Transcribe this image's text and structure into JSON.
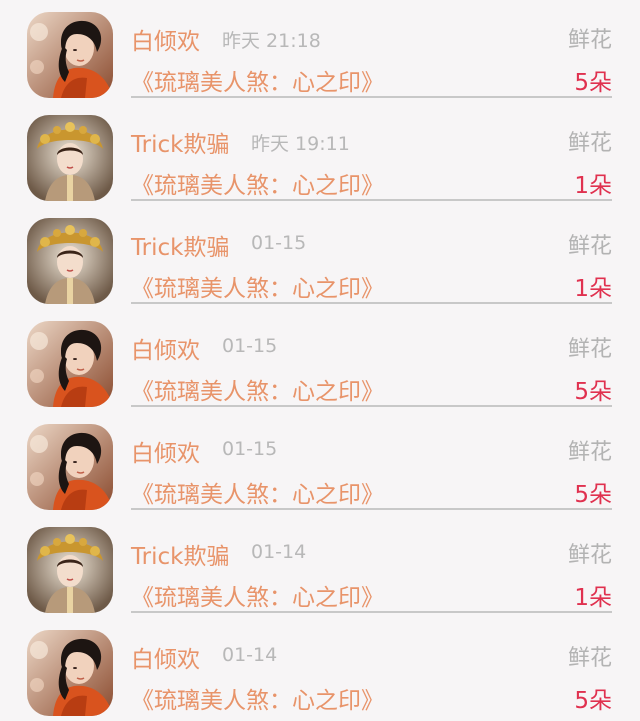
{
  "colors": {
    "background": "#f7f5f6",
    "name": "#e8946a",
    "time": "#b8b8b8",
    "kind": "#b3b3b3",
    "count": "#e0314f",
    "divider": "#c8c8c8"
  },
  "records": [
    {
      "avatar": "avatar-red-robe",
      "name": "白倾欢",
      "time": "昨天 21:18",
      "kind": "鲜花",
      "work": "《琉璃美人煞：心之印》",
      "count": "5朵"
    },
    {
      "avatar": "avatar-golden-headdress",
      "name": "Trick欺骗",
      "time": "昨天 19:11",
      "kind": "鲜花",
      "work": "《琉璃美人煞：心之印》",
      "count": "1朵"
    },
    {
      "avatar": "avatar-golden-headdress",
      "name": "Trick欺骗",
      "time": "01-15",
      "kind": "鲜花",
      "work": "《琉璃美人煞：心之印》",
      "count": "1朵"
    },
    {
      "avatar": "avatar-red-robe",
      "name": "白倾欢",
      "time": "01-15",
      "kind": "鲜花",
      "work": "《琉璃美人煞：心之印》",
      "count": "5朵"
    },
    {
      "avatar": "avatar-red-robe",
      "name": "白倾欢",
      "time": "01-15",
      "kind": "鲜花",
      "work": "《琉璃美人煞：心之印》",
      "count": "5朵"
    },
    {
      "avatar": "avatar-golden-headdress",
      "name": "Trick欺骗",
      "time": "01-14",
      "kind": "鲜花",
      "work": "《琉璃美人煞：心之印》",
      "count": "1朵"
    },
    {
      "avatar": "avatar-red-robe",
      "name": "白倾欢",
      "time": "01-14",
      "kind": "鲜花",
      "work": "《琉璃美人煞：心之印》",
      "count": "5朵"
    }
  ]
}
